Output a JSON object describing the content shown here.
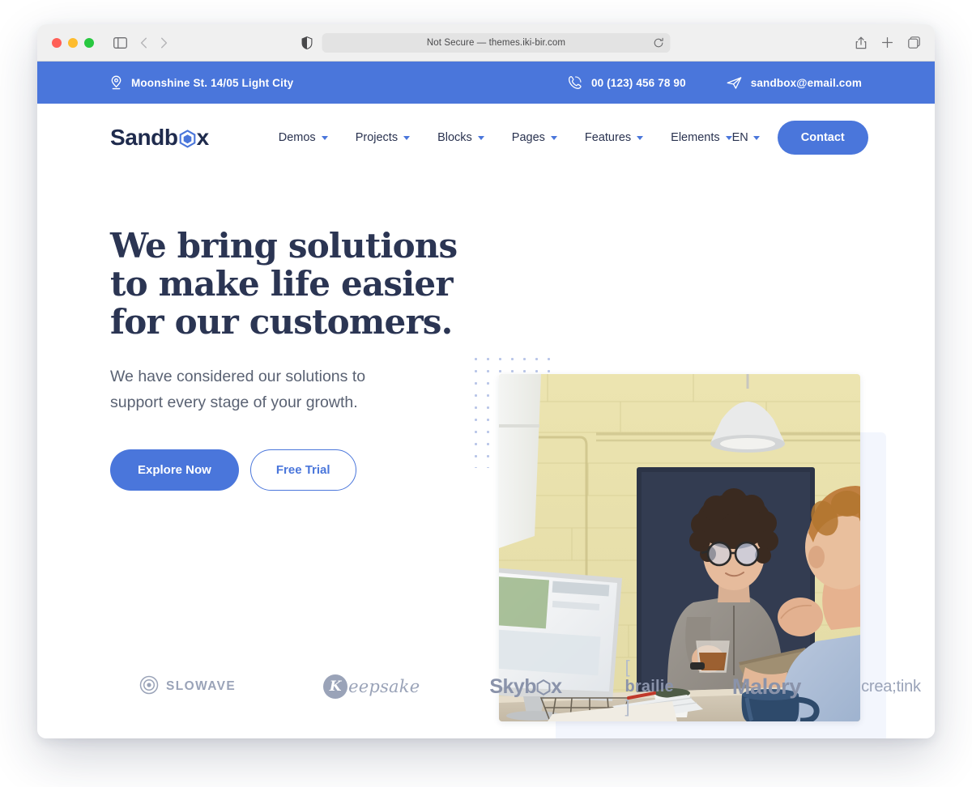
{
  "browser": {
    "url_text": "Not Secure — themes.iki-bir.com",
    "shield_icon": "shield-icon",
    "reload_icon": "reload-icon",
    "sidebar_icon": "sidebar-toggle-icon",
    "back_icon": "chevron-left-icon",
    "forward_icon": "chevron-right-icon",
    "share_icon": "share-icon",
    "new_tab_icon": "plus-icon",
    "tabs_icon": "tab-overview-icon"
  },
  "topbar": {
    "address": "Moonshine St. 14/05 Light City",
    "address_icon": "location-pin-icon",
    "phone": "00 (123) 456 78 90",
    "phone_icon": "phone-icon",
    "email": "sandbox@email.com",
    "email_icon": "paper-plane-icon",
    "bg_color": "#4a76db"
  },
  "nav": {
    "logo_part1": "Sandb",
    "logo_part2": "x",
    "logo_hex_icon": "hexagon-icon",
    "items": [
      {
        "label": "Demos"
      },
      {
        "label": "Projects"
      },
      {
        "label": "Blocks"
      },
      {
        "label": "Pages"
      },
      {
        "label": "Features"
      },
      {
        "label": "Elements"
      }
    ],
    "language": "EN",
    "contact_label": "Contact",
    "accent_color": "#4a76db"
  },
  "hero": {
    "title_line1": "We bring solutions",
    "title_line2": "to make life easier",
    "title_line3": "for our customers.",
    "subtitle": "We have considered our solutions to support every stage of your growth.",
    "primary_button": "Explore Now",
    "secondary_button": "Free Trial",
    "title_color": "#2b3553",
    "image_alt": "two colleagues talking in an office with an iMac, yellow brick wall and chalkboard"
  },
  "clients": [
    {
      "name": "SLOWAVE",
      "icon": "target-icon"
    },
    {
      "name": "Keepsake",
      "initial": "K"
    },
    {
      "name": "Skybox"
    },
    {
      "name": "brailie",
      "bracket_left": "[",
      "bracket_right": "]"
    },
    {
      "name": "Malory"
    },
    {
      "name": "crea;tink"
    }
  ]
}
